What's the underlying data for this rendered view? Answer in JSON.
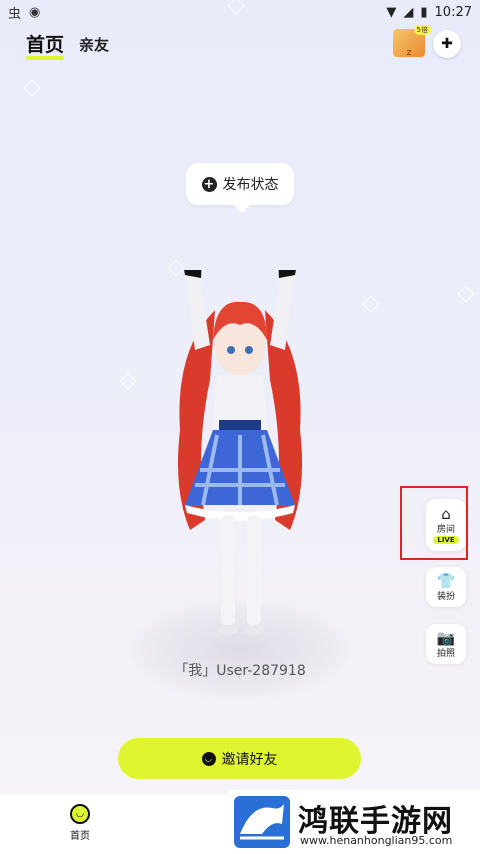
{
  "status_bar": {
    "time": "10:27",
    "left_icons": [
      "bug-icon",
      "cn-icon"
    ]
  },
  "header": {
    "tabs": [
      {
        "label": "首页"
      },
      {
        "label": "亲友"
      }
    ],
    "promo_badge": "5倍",
    "promo_text": "Z"
  },
  "bubble": {
    "label": "发布状态"
  },
  "character": {
    "name": "「我」User-287918"
  },
  "side_buttons": [
    {
      "label": "房间",
      "badge": "LIVE",
      "icon": "house-icon"
    },
    {
      "label": "装扮",
      "icon": "shirt-icon"
    },
    {
      "label": "拍照",
      "icon": "camera-icon"
    }
  ],
  "invite_button": {
    "label": "邀请好友"
  },
  "bottom_nav": {
    "home_label": "首页"
  },
  "watermark": {
    "title": "鸿联手游网",
    "url": "www.henanhonglian95.com"
  },
  "colors": {
    "accent": "#dff52f",
    "highlight": "#e02424"
  }
}
